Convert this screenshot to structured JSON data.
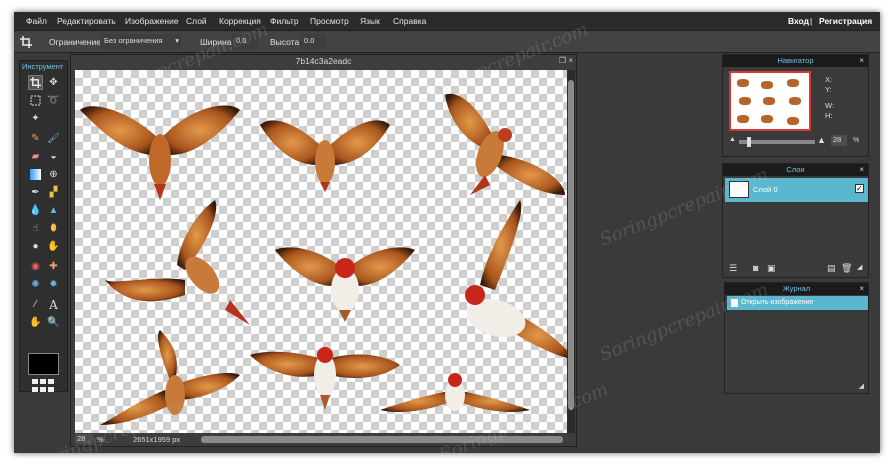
{
  "menu": {
    "items": [
      "Файл",
      "Редактировать",
      "Изображение",
      "Слой",
      "Коррекция",
      "Фильтр",
      "Просмотр",
      "Язык",
      "Справка"
    ],
    "login": "Вход",
    "separator": "|",
    "register": "Регистрация"
  },
  "options": {
    "constraint_label": "Ограничение:",
    "constraint_value": "Без ограничения",
    "width_label": "Ширина:",
    "width_value": "0.0",
    "height_label": "Высота:",
    "height_value": "0.0"
  },
  "toolbox": {
    "title": "Инструмент",
    "text_tool": "A",
    "tools": [
      "crop-icon",
      "move-icon",
      "marquee-icon",
      "lasso-icon",
      "magic-wand-icon",
      "pencil-icon",
      "brush-icon",
      "eraser-icon",
      "bucket-icon",
      "gradient-icon",
      "clone-icon",
      "color-replace-icon",
      "drawing-icon",
      "blur-icon",
      "sharpen-icon",
      "smudge-icon",
      "sponge-icon",
      "dodge-icon",
      "burn-icon",
      "red-eye-icon",
      "spot-heal-icon",
      "bloat-icon",
      "pinch-icon",
      "color-picker-icon",
      "text-icon",
      "hand-icon",
      "zoom-icon"
    ]
  },
  "canvas": {
    "title": "7b14c3a2eadc",
    "zoom_value": "28",
    "zoom_unit": "%",
    "dimensions": "2651x1959 px"
  },
  "navigator": {
    "title": "Навигатор",
    "close": "×",
    "x_label": "X:",
    "y_label": "Y:",
    "w_label": "W:",
    "h_label": "H:",
    "zoom_value": "28",
    "zoom_unit": "%"
  },
  "layers": {
    "title": "Слои",
    "close": "×",
    "layer_name": "Слой 0",
    "check": "✓"
  },
  "history": {
    "title": "Журнал",
    "close": "×",
    "entry": "Открыть изображение"
  },
  "watermark": "Soringpcrepair.com"
}
